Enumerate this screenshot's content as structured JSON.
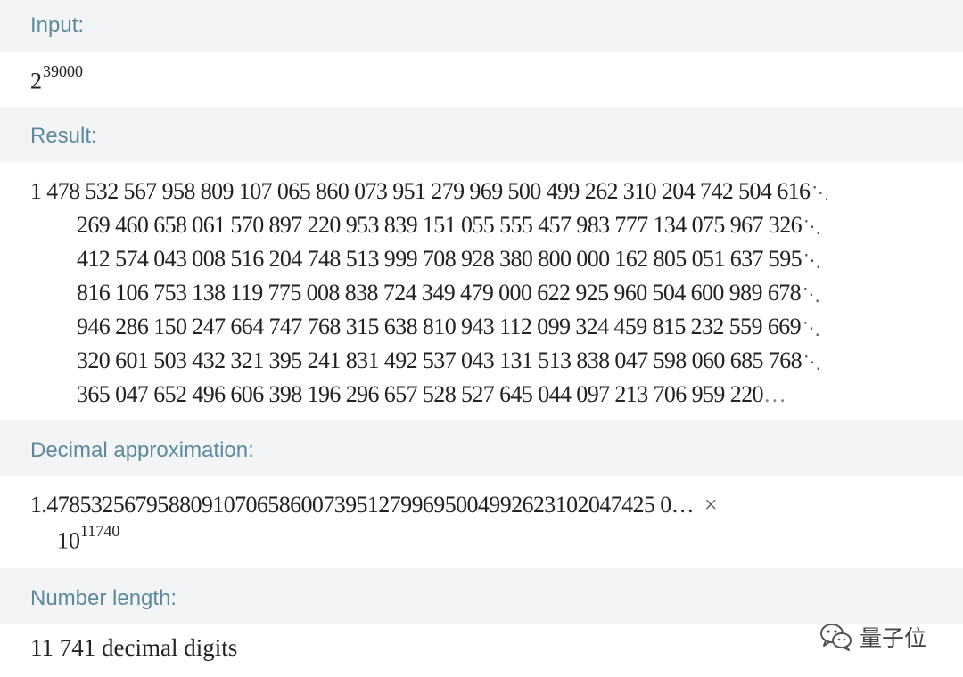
{
  "pods": {
    "input": {
      "title": "Input:",
      "base": "2",
      "exponent": "39000"
    },
    "result": {
      "title": "Result:",
      "lines": [
        "1 478 532 567 958 809 107 065 860 073 951 279 969 500 499 262 310 204 742 504 616",
        "269 460 658 061 570 897 220 953 839 151 055 555 457 983 777 134 075 967 326",
        "412 574 043 008 516 204 748 513 999 708 928 380 800 000 162 805 051 637 595",
        "816 106 753 138 119 775 008 838 724 349 479 000 622 925 960 504 600 989 678",
        "946 286 150 247 664 747 768 315 638 810 943 112 099 324 459 815 232 559 669",
        "320 601 503 432 321 395 241 831 492 537 043 131 513 838 047 598 060 685 768",
        "365 047 652 496 606 398 196 296 657 528 527 645 044 097 213 706 959 220"
      ],
      "continuation_mark": "⋱",
      "truncation_mark": "…"
    },
    "decimal": {
      "title": "Decimal approximation:",
      "mantissa": "1.4785325679588091070658600739512799695004992623102047425 0…",
      "times": "×",
      "power_base": "10",
      "power_exponent": "11740"
    },
    "length": {
      "title": "Number length:",
      "value": "11 741 decimal digits"
    }
  },
  "watermark": {
    "text": "量子位",
    "icon": "wechat-icon"
  }
}
